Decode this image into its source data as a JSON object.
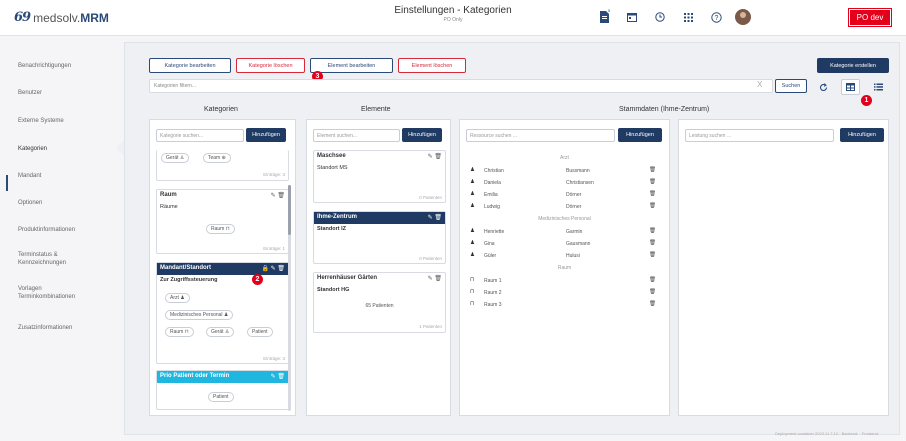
{
  "app": {
    "logo_mark": "69",
    "logo_prefix": "medsolv.",
    "logo_suffix": "MRM"
  },
  "header": {
    "title": "Einstellungen - Kategorien",
    "subtitle": "PO Only",
    "badge": "PO dev",
    "doc_badge": "5"
  },
  "sidebar": [
    "Benachrichtigungen",
    "Benutzer",
    "Externe Systeme",
    "Kategorien",
    "Mandant",
    "Optionen",
    "Produktinformationen",
    "Terminstatus &",
    "Kennzeichnungen",
    "Vorlagen",
    "Terminkombinationen",
    "Zusatzinformationen"
  ],
  "toolbar": {
    "edit_category": "Kategorie bearbeiten",
    "delete_category": "Kategorie löschen",
    "edit_element": "Element bearbeiten",
    "delete_element": "Element löschen",
    "create_category": "Kategorie erstellen",
    "filter_placeholder": "Kategorien filtern...",
    "clear": "X",
    "search": "Suchen"
  },
  "markers": [
    "1",
    "2",
    "3"
  ],
  "columns": {
    "categories": "Kategorien",
    "elements": "Elemente",
    "master": "Stammdaten (Ihme-Zentrum)"
  },
  "categories": {
    "search_placeholder": "Kategorie suchen...",
    "add": "Hinzufügen",
    "cards": [
      {
        "chips": [
          "Gerät",
          "Team"
        ],
        "count": "Einträge: 3"
      },
      {
        "title": "Raum",
        "sub": "Räume",
        "chips": [
          "Raum"
        ],
        "count": "Einträge: 1"
      },
      {
        "title": "Mandant/Standort",
        "sub": "Zur Zugriffssteuerung",
        "chips": [
          "Arzt",
          "Medizinisches Personal",
          "Raum",
          "Gerät",
          "Patient"
        ],
        "count": "Einträge: 3"
      },
      {
        "title": "Prio Patient oder Termin",
        "chips": [
          "Patient"
        ]
      }
    ]
  },
  "elements": {
    "search_placeholder": "Element suchen...",
    "add": "Hinzufügen",
    "cards": [
      {
        "title": "Maschsee",
        "sub": "Standort MS",
        "count": "0 Patienten"
      },
      {
        "title": "Ihme-Zentrum",
        "sub": "Standort IZ",
        "count": "0 Patienten"
      },
      {
        "title": "Herrenhäuser Gärten",
        "sub": "Standort HG",
        "center": "65 Patienten",
        "count": "1 Patienten"
      }
    ]
  },
  "resources": {
    "search_placeholder": "Ressource suchen ...",
    "add": "Hinzufügen",
    "groups": [
      {
        "label": "Arzt",
        "rows": [
          {
            "first": "Christian",
            "last": "Bussmann"
          },
          {
            "first": "Daniela",
            "last": "Christiansen"
          },
          {
            "first": "Emilia",
            "last": "Dörner"
          },
          {
            "first": "Ludwig",
            "last": "Dörner"
          }
        ]
      },
      {
        "label": "Medizinisches Personal",
        "rows": [
          {
            "first": "Henriette",
            "last": "Garmin"
          },
          {
            "first": "Gina",
            "last": "Gausmann"
          },
          {
            "first": "Güler",
            "last": "Hulusi"
          }
        ]
      },
      {
        "label": "Raum",
        "rows": [
          {
            "first": "Raum 1",
            "last": ""
          },
          {
            "first": "Raum 2",
            "last": ""
          },
          {
            "first": "Raum 3",
            "last": ""
          }
        ]
      }
    ]
  },
  "services": {
    "search_placeholder": "Leistung suchen ...",
    "add": "Hinzufügen"
  },
  "footer": "Deployment container 2023.11.7.12 · Backend: · Frontend:"
}
